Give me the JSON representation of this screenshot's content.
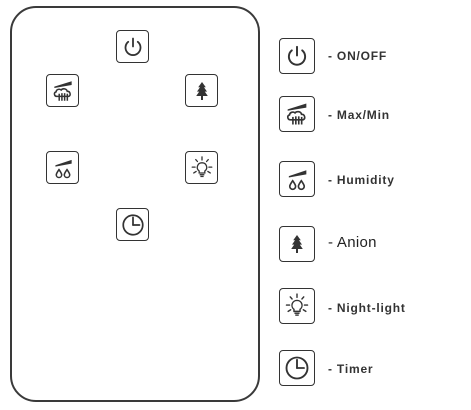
{
  "remote": {
    "buttons": [
      {
        "function": "power",
        "icon": "power-icon"
      },
      {
        "function": "fan-speed",
        "icon": "fan-speed-icon"
      },
      {
        "function": "anion",
        "icon": "tree-icon"
      },
      {
        "function": "humidity",
        "icon": "humidity-icon"
      },
      {
        "function": "night-light",
        "icon": "light-bulb-icon"
      },
      {
        "function": "timer",
        "icon": "clock-icon"
      }
    ]
  },
  "legend": {
    "items": [
      {
        "icon": "power-icon",
        "label": "- ON/OFF"
      },
      {
        "icon": "fan-speed-icon",
        "label": "- Max/Min"
      },
      {
        "icon": "humidity-icon",
        "label": "- Humidity"
      },
      {
        "icon": "tree-icon",
        "label": "- Anion"
      },
      {
        "icon": "light-bulb-icon",
        "label": "- Night-light"
      },
      {
        "icon": "clock-icon",
        "label": "- Timer"
      }
    ]
  }
}
